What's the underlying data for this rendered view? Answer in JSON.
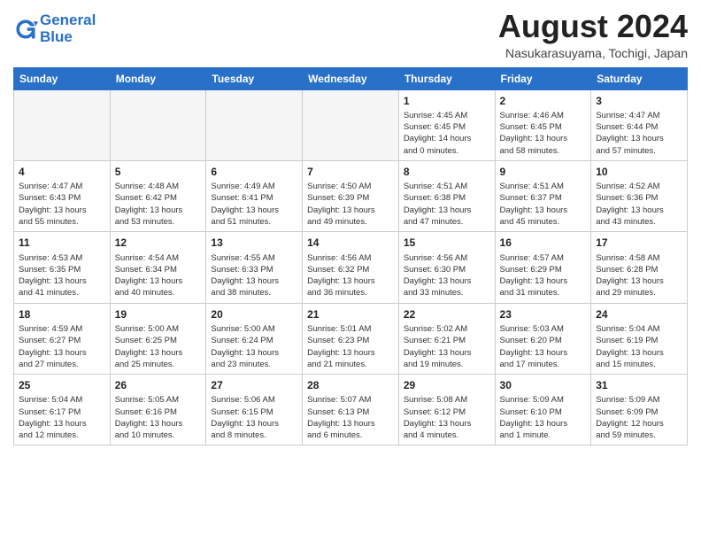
{
  "header": {
    "logo_line1": "General",
    "logo_line2": "Blue",
    "month_title": "August 2024",
    "location": "Nasukarasuyama, Tochigi, Japan"
  },
  "weekdays": [
    "Sunday",
    "Monday",
    "Tuesday",
    "Wednesday",
    "Thursday",
    "Friday",
    "Saturday"
  ],
  "weeks": [
    [
      {
        "day": "",
        "info": ""
      },
      {
        "day": "",
        "info": ""
      },
      {
        "day": "",
        "info": ""
      },
      {
        "day": "",
        "info": ""
      },
      {
        "day": "1",
        "info": "Sunrise: 4:45 AM\nSunset: 6:45 PM\nDaylight: 14 hours\nand 0 minutes."
      },
      {
        "day": "2",
        "info": "Sunrise: 4:46 AM\nSunset: 6:45 PM\nDaylight: 13 hours\nand 58 minutes."
      },
      {
        "day": "3",
        "info": "Sunrise: 4:47 AM\nSunset: 6:44 PM\nDaylight: 13 hours\nand 57 minutes."
      }
    ],
    [
      {
        "day": "4",
        "info": "Sunrise: 4:47 AM\nSunset: 6:43 PM\nDaylight: 13 hours\nand 55 minutes."
      },
      {
        "day": "5",
        "info": "Sunrise: 4:48 AM\nSunset: 6:42 PM\nDaylight: 13 hours\nand 53 minutes."
      },
      {
        "day": "6",
        "info": "Sunrise: 4:49 AM\nSunset: 6:41 PM\nDaylight: 13 hours\nand 51 minutes."
      },
      {
        "day": "7",
        "info": "Sunrise: 4:50 AM\nSunset: 6:39 PM\nDaylight: 13 hours\nand 49 minutes."
      },
      {
        "day": "8",
        "info": "Sunrise: 4:51 AM\nSunset: 6:38 PM\nDaylight: 13 hours\nand 47 minutes."
      },
      {
        "day": "9",
        "info": "Sunrise: 4:51 AM\nSunset: 6:37 PM\nDaylight: 13 hours\nand 45 minutes."
      },
      {
        "day": "10",
        "info": "Sunrise: 4:52 AM\nSunset: 6:36 PM\nDaylight: 13 hours\nand 43 minutes."
      }
    ],
    [
      {
        "day": "11",
        "info": "Sunrise: 4:53 AM\nSunset: 6:35 PM\nDaylight: 13 hours\nand 41 minutes."
      },
      {
        "day": "12",
        "info": "Sunrise: 4:54 AM\nSunset: 6:34 PM\nDaylight: 13 hours\nand 40 minutes."
      },
      {
        "day": "13",
        "info": "Sunrise: 4:55 AM\nSunset: 6:33 PM\nDaylight: 13 hours\nand 38 minutes."
      },
      {
        "day": "14",
        "info": "Sunrise: 4:56 AM\nSunset: 6:32 PM\nDaylight: 13 hours\nand 36 minutes."
      },
      {
        "day": "15",
        "info": "Sunrise: 4:56 AM\nSunset: 6:30 PM\nDaylight: 13 hours\nand 33 minutes."
      },
      {
        "day": "16",
        "info": "Sunrise: 4:57 AM\nSunset: 6:29 PM\nDaylight: 13 hours\nand 31 minutes."
      },
      {
        "day": "17",
        "info": "Sunrise: 4:58 AM\nSunset: 6:28 PM\nDaylight: 13 hours\nand 29 minutes."
      }
    ],
    [
      {
        "day": "18",
        "info": "Sunrise: 4:59 AM\nSunset: 6:27 PM\nDaylight: 13 hours\nand 27 minutes."
      },
      {
        "day": "19",
        "info": "Sunrise: 5:00 AM\nSunset: 6:25 PM\nDaylight: 13 hours\nand 25 minutes."
      },
      {
        "day": "20",
        "info": "Sunrise: 5:00 AM\nSunset: 6:24 PM\nDaylight: 13 hours\nand 23 minutes."
      },
      {
        "day": "21",
        "info": "Sunrise: 5:01 AM\nSunset: 6:23 PM\nDaylight: 13 hours\nand 21 minutes."
      },
      {
        "day": "22",
        "info": "Sunrise: 5:02 AM\nSunset: 6:21 PM\nDaylight: 13 hours\nand 19 minutes."
      },
      {
        "day": "23",
        "info": "Sunrise: 5:03 AM\nSunset: 6:20 PM\nDaylight: 13 hours\nand 17 minutes."
      },
      {
        "day": "24",
        "info": "Sunrise: 5:04 AM\nSunset: 6:19 PM\nDaylight: 13 hours\nand 15 minutes."
      }
    ],
    [
      {
        "day": "25",
        "info": "Sunrise: 5:04 AM\nSunset: 6:17 PM\nDaylight: 13 hours\nand 12 minutes."
      },
      {
        "day": "26",
        "info": "Sunrise: 5:05 AM\nSunset: 6:16 PM\nDaylight: 13 hours\nand 10 minutes."
      },
      {
        "day": "27",
        "info": "Sunrise: 5:06 AM\nSunset: 6:15 PM\nDaylight: 13 hours\nand 8 minutes."
      },
      {
        "day": "28",
        "info": "Sunrise: 5:07 AM\nSunset: 6:13 PM\nDaylight: 13 hours\nand 6 minutes."
      },
      {
        "day": "29",
        "info": "Sunrise: 5:08 AM\nSunset: 6:12 PM\nDaylight: 13 hours\nand 4 minutes."
      },
      {
        "day": "30",
        "info": "Sunrise: 5:09 AM\nSunset: 6:10 PM\nDaylight: 13 hours\nand 1 minute."
      },
      {
        "day": "31",
        "info": "Sunrise: 5:09 AM\nSunset: 6:09 PM\nDaylight: 12 hours\nand 59 minutes."
      }
    ]
  ]
}
